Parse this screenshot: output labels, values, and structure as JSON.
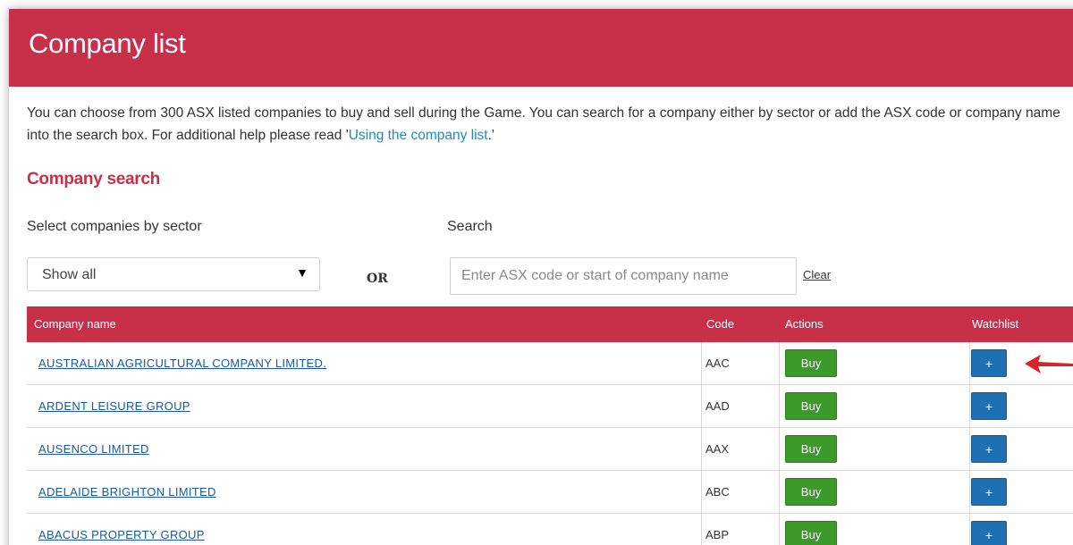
{
  "header": {
    "title": "Company list"
  },
  "intro": {
    "text_before_link": "You can choose from 300 ASX listed companies to buy and sell during the Game. You can search for a company either by sector or add the ASX code or company name into the search box. For additional help please read '",
    "link_text": "Using the company list",
    "text_after_link": ".'"
  },
  "search_section": {
    "title": "Company search",
    "sector_label": "Select companies by sector",
    "sector_selected": "Show all",
    "or_label": "OR",
    "search_label": "Search",
    "search_placeholder": "Enter ASX code or start of company name",
    "search_value": "",
    "clear_label": "Clear"
  },
  "table": {
    "columns": {
      "name": "Company name",
      "code": "Code",
      "actions": "Actions",
      "watchlist": "Watchlist"
    },
    "rows": [
      {
        "name": "AUSTRALIAN AGRICULTURAL COMPANY LIMITED.",
        "code": "AAC",
        "action_label": "Buy",
        "watch_label": "+"
      },
      {
        "name": "ARDENT LEISURE GROUP",
        "code": "AAD",
        "action_label": "Buy",
        "watch_label": "+"
      },
      {
        "name": "AUSENCO LIMITED",
        "code": "AAX",
        "action_label": "Buy",
        "watch_label": "+"
      },
      {
        "name": "ADELAIDE BRIGHTON LIMITED",
        "code": "ABC",
        "action_label": "Buy",
        "watch_label": "+"
      },
      {
        "name": "ABACUS PROPERTY GROUP",
        "code": "ABP",
        "action_label": "Buy",
        "watch_label": "+"
      }
    ]
  },
  "annotation": {
    "icon": "red-arrow-left-icon",
    "color": "#d8232a"
  },
  "colors": {
    "brand": "#c8304a",
    "link": "#1a5aa0",
    "buy": "#3c9a2a",
    "watch": "#1f6fb3"
  }
}
